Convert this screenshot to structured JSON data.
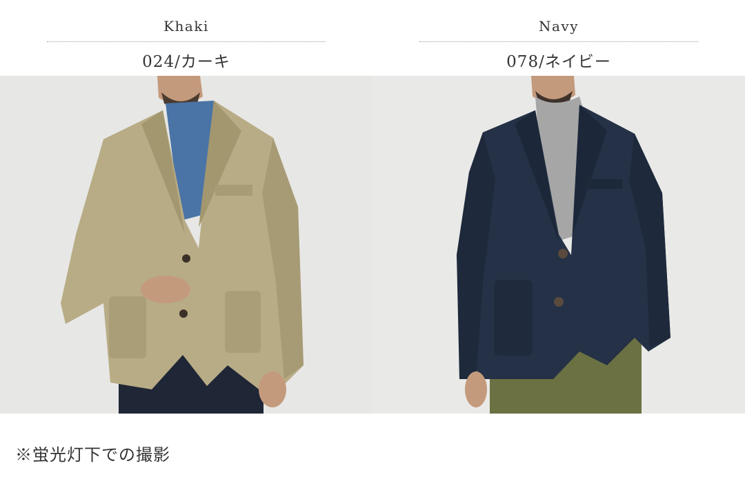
{
  "variants": [
    {
      "name_en": "Khaki",
      "code_label": "024/カーキ",
      "jacket_color": "#b8ac86",
      "inner_color": "#4a74a6",
      "trouser_color": "#1f2636",
      "photo_icon": "product-photo-icon"
    },
    {
      "name_en": "Navy",
      "code_label": "078/ネイビー",
      "jacket_color": "#243146",
      "inner_color": "#a6a6a6",
      "trouser_color": "#6b7142",
      "photo_icon": "product-photo-icon"
    }
  ],
  "footnote": "※蛍光灯下での撮影"
}
